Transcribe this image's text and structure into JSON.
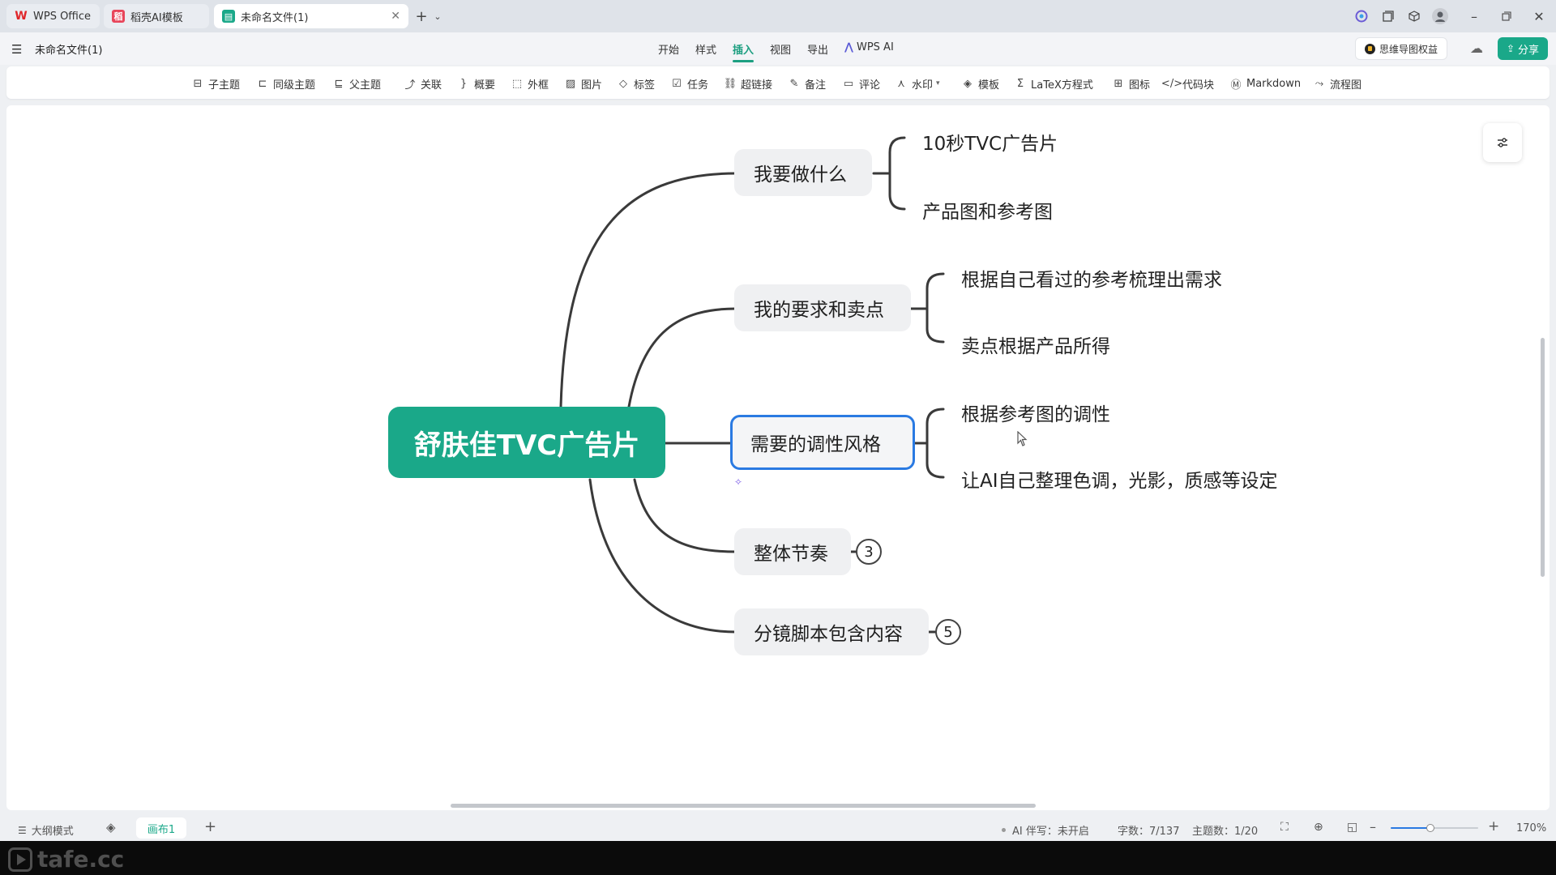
{
  "tabs": [
    {
      "label": "WPS Office",
      "icon": "wps-logo-icon"
    },
    {
      "label": "稻壳AI模板",
      "icon": "docer-icon"
    },
    {
      "label": "未命名文件(1)",
      "icon": "mindmap-file-icon"
    }
  ],
  "document": {
    "title": "未命名文件(1)"
  },
  "menu": {
    "items": [
      "开始",
      "样式",
      "插入",
      "视图",
      "导出",
      "WPS AI"
    ],
    "active": "插入",
    "rights_button": "思维导图权益",
    "share_button": "分享"
  },
  "toolbar": {
    "items": [
      "子主题",
      "同级主题",
      "父主题",
      "关联",
      "概要",
      "外框",
      "图片",
      "标签",
      "任务",
      "超链接",
      "备注",
      "评论",
      "水印",
      "模板",
      "LaTeX方程式",
      "图标",
      "代码块",
      "Markdown",
      "流程图"
    ]
  },
  "mindmap": {
    "root": "舒肤佳TVC广告片",
    "branches": [
      {
        "label": "我要做什么",
        "children": [
          "10秒TVC广告片",
          "产品图和参考图"
        ]
      },
      {
        "label": "我的要求和卖点",
        "children": [
          "根据自己看过的参考梳理出需求",
          "卖点根据产品所得"
        ]
      },
      {
        "label": "需要的调性风格",
        "children": [
          "根据参考图的调性",
          "让AI自己整理色调，光影，质感等设定"
        ]
      },
      {
        "label": "整体节奏",
        "collapsed_count": "3"
      },
      {
        "label": "分镜脚本包含内容",
        "collapsed_count": "5"
      }
    ]
  },
  "status": {
    "outline_mode": "大纲模式",
    "canvas_tab": "画布1",
    "ai_companion": "AI 伴写：未开启",
    "word_count": "字数：7/137",
    "topic_count": "主题数：1/20",
    "zoom": "170%",
    "zoom_fraction": 0.45
  },
  "watermark": "tafe.cc",
  "colors": {
    "accent": "#1aa889",
    "selection": "#2a7ae2",
    "share": "#1aa889"
  }
}
